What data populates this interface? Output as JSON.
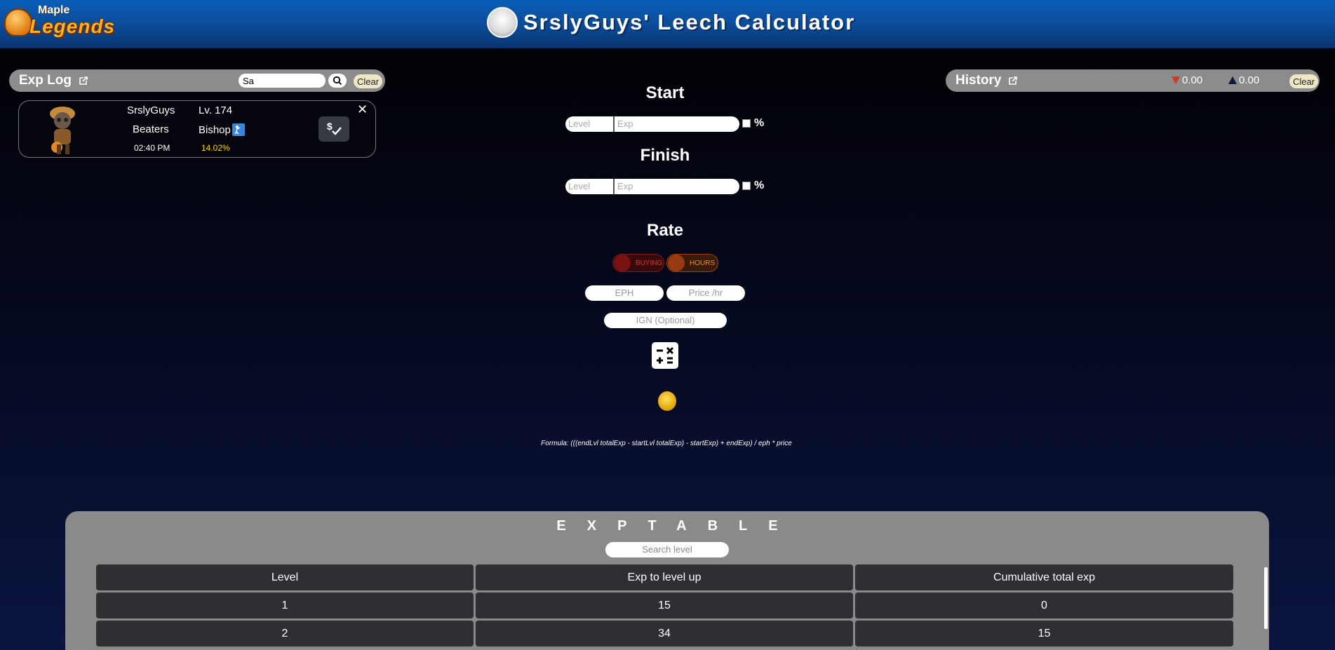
{
  "header": {
    "logo_top": "Maple",
    "logo_main": "Legends",
    "title": "SrslyGuys' Leech Calculator"
  },
  "exp_log": {
    "title": "Exp Log",
    "search_value": "Sa",
    "clear_label": "Clear",
    "entries": [
      {
        "name": "SrslyGuys",
        "level": "Lv. 174",
        "guild": "Beaters",
        "job": "Bishop",
        "time": "02:40 PM",
        "percent": "14.02%"
      }
    ]
  },
  "history": {
    "title": "History",
    "down_value": "0.00",
    "up_value": "0.00",
    "clear_label": "Clear",
    "colors": {
      "down": "#d23a1a",
      "up": "#0a1a40"
    }
  },
  "calculator": {
    "start_label": "Start",
    "finish_label": "Finish",
    "rate_label": "Rate",
    "level_placeholder": "Level",
    "exp_placeholder": "Exp",
    "percent_label": "%",
    "toggle_buying": "BUYING",
    "toggle_hours": "HOURS",
    "eph_placeholder": "EPH",
    "price_placeholder": "Price /hr",
    "ign_placeholder": "IGN (Optional)",
    "formula": "Formula: (((endLvl totalExp - startLvl totalExp) - startExp) + endExp) / eph * price"
  },
  "exp_table": {
    "heading": "EXPTABLE",
    "search_placeholder": "Search level",
    "columns": [
      "Level",
      "Exp to level up",
      "Cumulative total exp"
    ],
    "rows": [
      [
        "1",
        "15",
        "0"
      ],
      [
        "2",
        "34",
        "15"
      ]
    ]
  }
}
